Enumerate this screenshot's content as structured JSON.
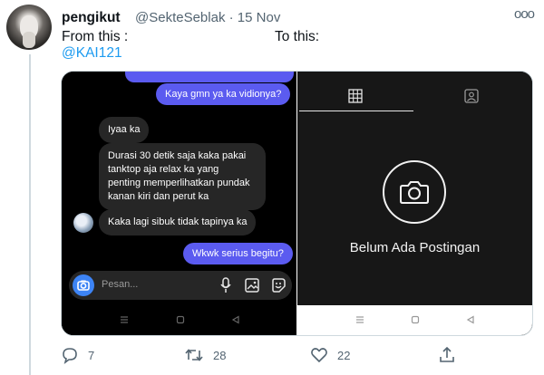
{
  "tweet": {
    "display_name": "pengikut",
    "handle": "@SekteSeblak",
    "separator": "·",
    "date": "15 Nov",
    "more_glyph": "ooo",
    "text_left": "From this :",
    "text_right": "To this:",
    "mention": "@KAI121"
  },
  "chat": {
    "msg_out_1": "Kaya gmn ya ka vidionya?",
    "msg_in_1": "Iyaa ka",
    "msg_in_2": [
      "Durasi 30 detik saja kaka pakai",
      "tanktop aja relax ka yang",
      "penting memperlihatkan pundak",
      "kanan kiri dan perut ka"
    ],
    "msg_in_3": "Kaka lagi sibuk tidak tapinya ka",
    "msg_out_2": "Wkwk serius begitu?",
    "input_placeholder": "Pesan..."
  },
  "profile": {
    "empty_state": "Belum Ada Postingan"
  },
  "actions": {
    "replies": "7",
    "retweets": "28",
    "likes": "22"
  },
  "colors": {
    "accent_blue": "#1d9bf0",
    "bubble_purple": "#5b5bf0",
    "muted": "#536471"
  }
}
